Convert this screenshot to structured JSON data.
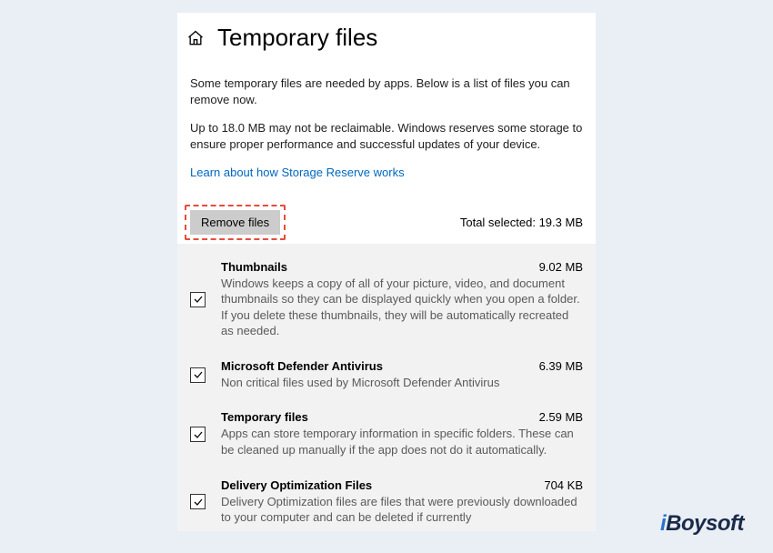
{
  "header": {
    "title": "Temporary files"
  },
  "intro": {
    "line1": "Some temporary files are needed by apps. Below is a list of files you can remove now.",
    "line2": "Up to 18.0 MB may not be reclaimable. Windows reserves some storage to ensure proper performance and successful updates of your device.",
    "link": "Learn about how Storage Reserve works"
  },
  "actions": {
    "remove_label": "Remove files",
    "total_label": "Total selected: 19.3 MB"
  },
  "items": [
    {
      "title": "Thumbnails",
      "size": "9.02 MB",
      "desc": "Windows keeps a copy of all of your picture, video, and document thumbnails so they can be displayed quickly when you open a folder. If you delete these thumbnails, they will be automatically recreated as needed."
    },
    {
      "title": "Microsoft Defender Antivirus",
      "size": "6.39 MB",
      "desc": "Non critical files used by Microsoft Defender Antivirus"
    },
    {
      "title": "Temporary files",
      "size": "2.59 MB",
      "desc": "Apps can store temporary information in specific folders. These can be cleaned up manually if the app does not do it automatically."
    },
    {
      "title": "Delivery Optimization Files",
      "size": "704 KB",
      "desc": "Delivery Optimization files are files that were previously downloaded to your computer and can be deleted if currently"
    }
  ],
  "watermark": {
    "brand_i": "i",
    "brand_rest": "Boysoft"
  }
}
